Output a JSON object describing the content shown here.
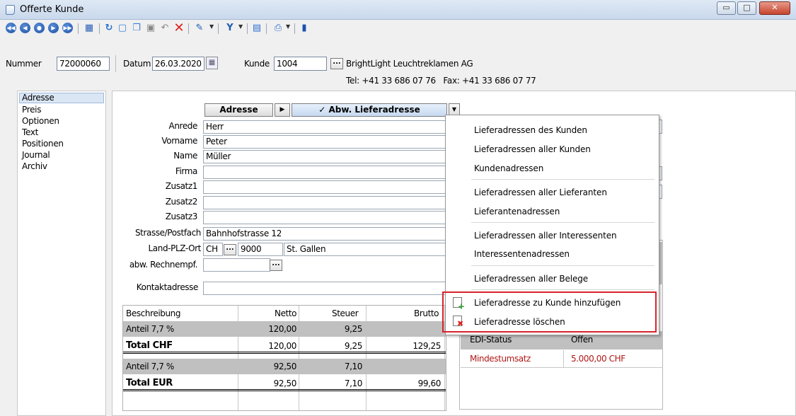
{
  "window": {
    "title": "Offerte Kunde",
    "controls": {
      "minimize": "▭",
      "maximize": "□",
      "close": "✕"
    }
  },
  "toolbar": {
    "nav_icons": [
      "first-record-icon",
      "previous-record-icon",
      "next-record-icon",
      "last-record-icon",
      "end-record-icon"
    ],
    "tool_icons": [
      "calendar-icon",
      "refresh-icon",
      "new-document-icon",
      "copy-document-icon",
      "save-icon",
      "undo-icon",
      "delete-icon",
      "tool-icon",
      "filter-icon",
      "print-preview-icon",
      "print-icon",
      "exit-icon"
    ]
  },
  "header": {
    "nummer_label": "Nummer",
    "nummer_value": "72000060",
    "datum_label": "Datum",
    "datum_value": "26.03.2020",
    "kunde_label": "Kunde",
    "kunde_value": "1004",
    "kunde_ellipsis": "...",
    "customer_name": "BrightLight Leuchtreklamen AG",
    "contact_line": "Tel: +41 33 686 07 76   Fax: +41 33 686 07 77"
  },
  "sidebar": {
    "items": [
      "Adresse",
      "Preis",
      "Optionen",
      "Text",
      "Positionen",
      "Journal",
      "Archiv"
    ],
    "selected": "Adresse"
  },
  "address_tabs": {
    "tab1": "Adresse",
    "arrow": "▶",
    "tab2": "✓ Abw. Lieferadresse",
    "dropdown": "▼"
  },
  "form": {
    "anrede_label": "Anrede",
    "anrede_value": "Herr",
    "vorname_label": "Vorname",
    "vorname_value": "Peter",
    "name_label": "Name",
    "name_value": "Müller",
    "firma_label": "Firma",
    "firma_value": "",
    "zusatz1_label": "Zusatz1",
    "zusatz1_value": "",
    "zusatz2_label": "Zusatz2",
    "zusatz2_value": "",
    "zusatz3_label": "Zusatz3",
    "zusatz3_value": "",
    "strasse_label": "Strasse/Postfach",
    "strasse_value": "Bahnhofstrasse 12",
    "land_label": "Land-PLZ-Ort",
    "land_value": "CH",
    "plz_value": "9000",
    "ort_value": "St. Gallen",
    "rechnempf_label": "abw. Rechnempf.",
    "kontakt_label": "Kontaktadresse",
    "ellipsis": "..."
  },
  "totals": {
    "headers": [
      "Beschreibung",
      "Netto",
      "Steuer",
      "Brutto"
    ],
    "rows": [
      {
        "desc": "Anteil 7,7 %",
        "netto": "120,00",
        "steuer": "9,25",
        "brutto": "",
        "style": "gray"
      },
      {
        "desc": "Total CHF",
        "netto": "120,00",
        "steuer": "9,25",
        "brutto": "129,25",
        "style": "total"
      },
      {
        "desc": "Anteil 7,7 %",
        "netto": "92,50",
        "steuer": "7,10",
        "brutto": "",
        "style": "gray"
      },
      {
        "desc": "Total EUR",
        "netto": "92,50",
        "steuer": "7,10",
        "brutto": "99,60",
        "style": "total"
      }
    ]
  },
  "status_panel": {
    "edi_label": "EDI-Status",
    "edi_value": "Offen",
    "min_label": "Mindestumsatz",
    "min_value": "5.000,00 CHF",
    "min_color": "#b01818"
  },
  "context_menu": {
    "items": [
      "Lieferadressen des Kunden",
      "Lieferadressen aller Kunden",
      "Kundenadressen",
      "Lieferadressen aller Lieferanten",
      "Lieferantenadressen",
      "Lieferadressen aller Interessenten",
      "Interessentenadressen",
      "Lieferadressen aller Belege",
      "Lieferadresse zu Kunde hinzufügen",
      "Lieferadresse löschen"
    ],
    "highlight_color": "#d9232a"
  }
}
